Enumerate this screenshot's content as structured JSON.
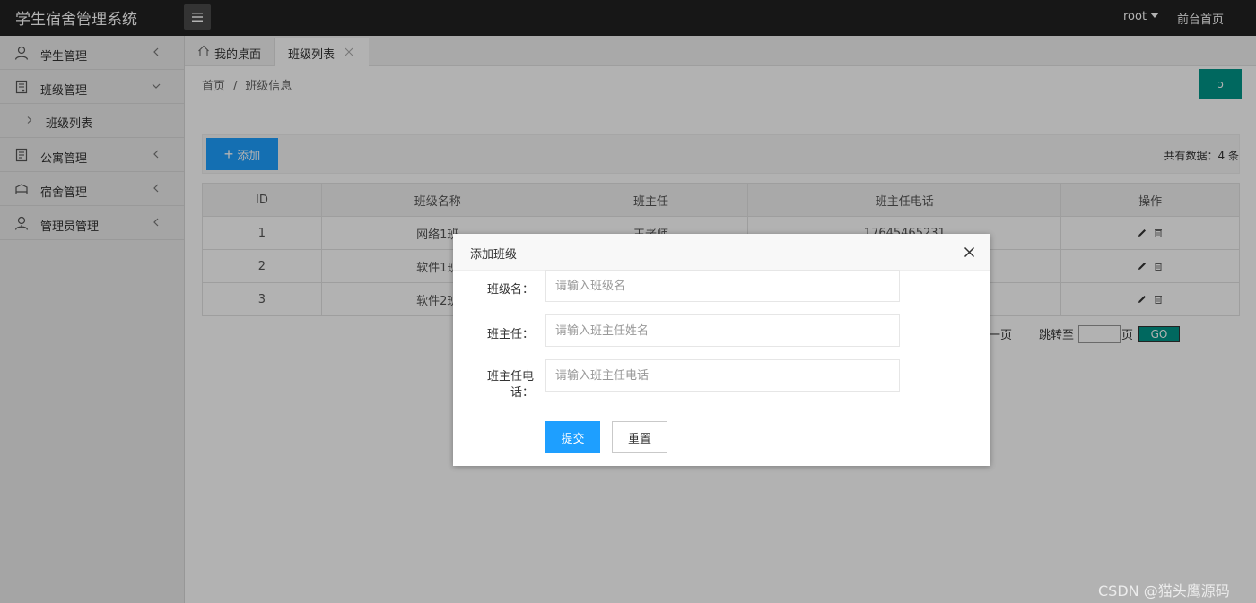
{
  "header": {
    "app_title": "学生宿舍管理系统",
    "user_label": "root",
    "front_link": "前台首页",
    "menu_icon": "hamburger-icon"
  },
  "sidebar": {
    "items": [
      {
        "label": "学生管理",
        "icon": "user-icon",
        "expanded": false
      },
      {
        "label": "班级管理",
        "icon": "document-icon",
        "expanded": true,
        "children": [
          {
            "label": "班级列表"
          }
        ]
      },
      {
        "label": "公寓管理",
        "icon": "book-icon",
        "expanded": false
      },
      {
        "label": "宿舍管理",
        "icon": "bed-icon",
        "expanded": false
      },
      {
        "label": "管理员管理",
        "icon": "admin-icon",
        "expanded": false
      }
    ]
  },
  "tabs": [
    {
      "label": "我的桌面",
      "icon": "home-icon",
      "active": false
    },
    {
      "label": "班级列表",
      "active": true,
      "closable": true
    }
  ],
  "breadcrumb": {
    "items": [
      "首页",
      "班级信息"
    ],
    "separator": "/"
  },
  "refresh_label": "ↄ",
  "toolbar": {
    "add_label": "添加",
    "add_icon": "plus-icon",
    "total_text": "共有数据：4 条"
  },
  "table": {
    "columns": [
      "ID",
      "班级名称",
      "班主任",
      "班主任电话",
      "操作"
    ],
    "rows": [
      [
        "1",
        "网络1班",
        "王老师",
        "17645465231"
      ],
      [
        "2",
        "软件1班",
        "",
        ""
      ],
      [
        "3",
        "软件2班",
        "",
        ""
      ]
    ],
    "row_actions": [
      "edit-icon",
      "trash-icon"
    ]
  },
  "pager": {
    "prev_label": "一页",
    "jump_label": "跳转至",
    "page_label": "页",
    "go_label": "GO"
  },
  "modal": {
    "title": "添加班级",
    "fields": [
      {
        "label": "班级名：",
        "placeholder": "请输入班级名"
      },
      {
        "label": "班主任：",
        "placeholder": "请输入班主任姓名"
      },
      {
        "label_line1": "班主任电",
        "label_line2": "话：",
        "placeholder": "请输入班主任电话"
      }
    ],
    "submit_label": "提交",
    "reset_label": "重置"
  },
  "watermark": "CSDN @猫头鹰源码",
  "colors": {
    "topbar": "#222222",
    "primary": "#1E9FFF",
    "teal": "#009688",
    "overlay": "rgba(0,0,0,0.3)"
  }
}
